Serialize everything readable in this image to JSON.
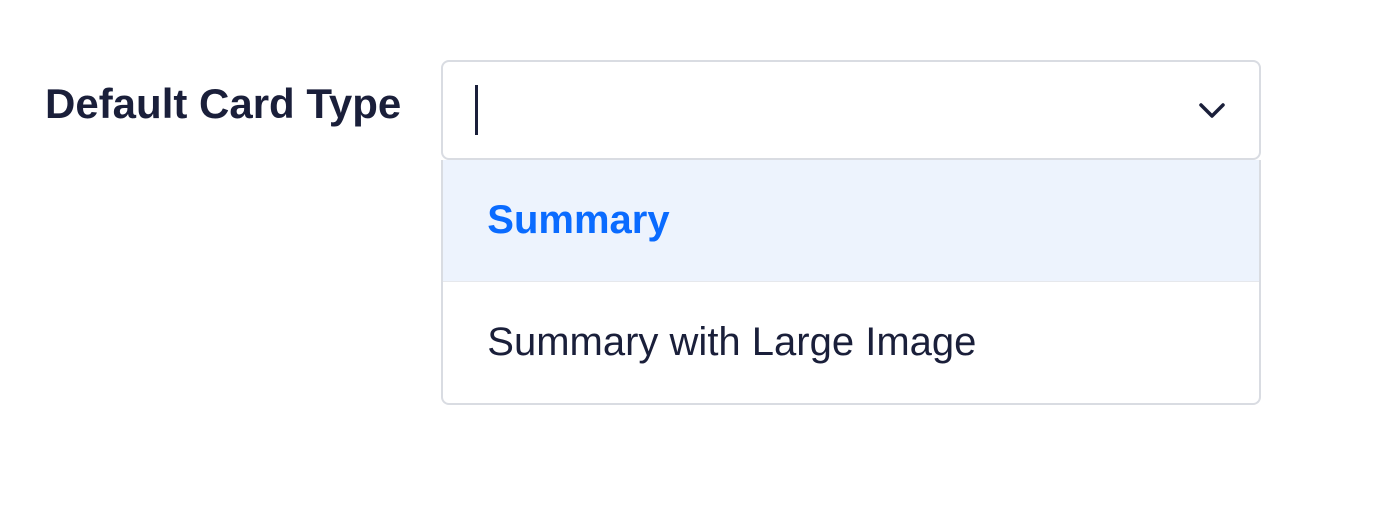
{
  "field": {
    "label": "Default Card Type",
    "value": "",
    "placeholder": ""
  },
  "dropdown": {
    "options": [
      {
        "label": "Summary",
        "highlighted": true
      },
      {
        "label": "Summary with Large Image",
        "highlighted": false
      }
    ]
  }
}
